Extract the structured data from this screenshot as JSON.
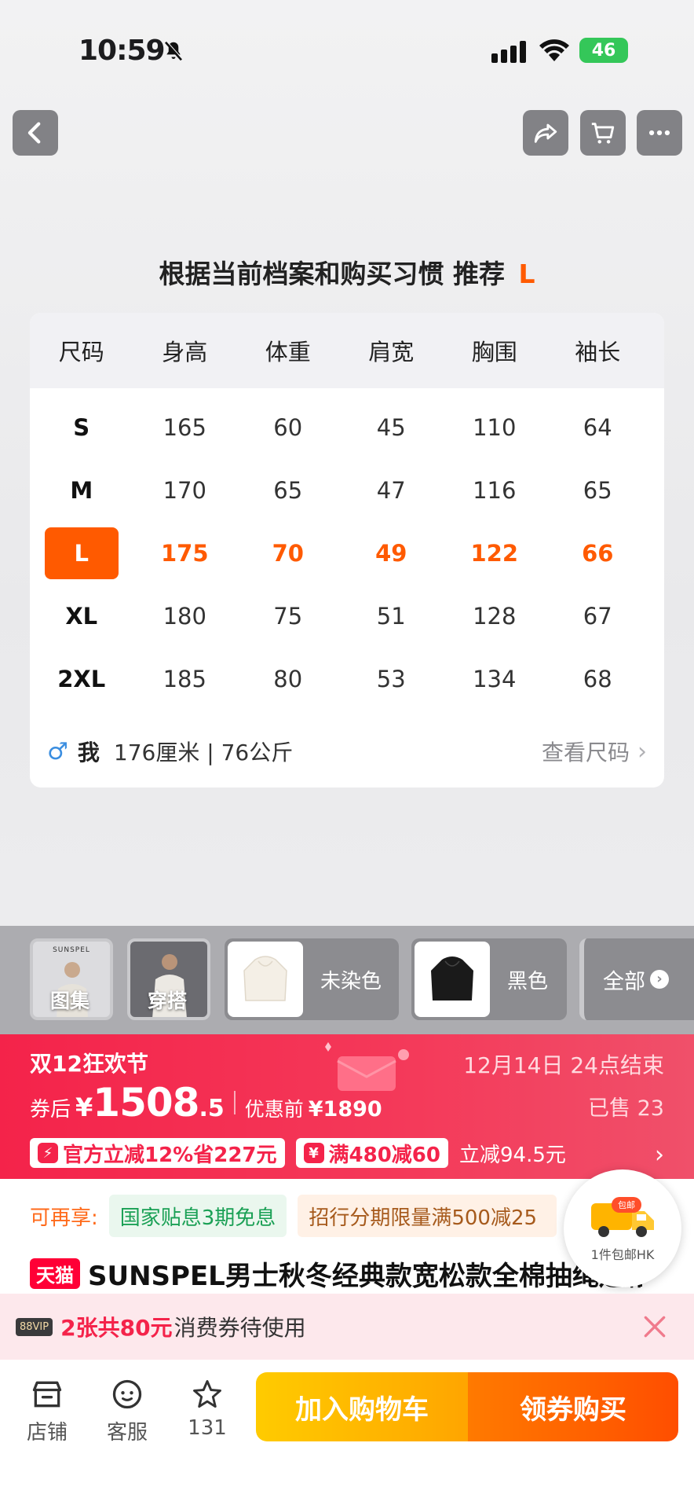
{
  "status_bar": {
    "time": "10:59",
    "battery": "46"
  },
  "recommend": {
    "text": "根据当前档案和购买习惯 推荐",
    "size": "L"
  },
  "size_table": {
    "headers": [
      "尺码",
      "身高",
      "体重",
      "肩宽",
      "胸围",
      "袖长"
    ],
    "rows": [
      [
        "S",
        "165",
        "60",
        "45",
        "110",
        "64"
      ],
      [
        "M",
        "170",
        "65",
        "47",
        "116",
        "65"
      ],
      [
        "L",
        "175",
        "70",
        "49",
        "122",
        "66"
      ],
      [
        "XL",
        "180",
        "75",
        "51",
        "128",
        "67"
      ],
      [
        "2XL",
        "185",
        "80",
        "53",
        "134",
        "68"
      ]
    ],
    "highlighted_row": "L",
    "me_label": "我",
    "me_stats": "176厘米 | 76公斤",
    "view_size": "查看尺码"
  },
  "thumbnails": {
    "gallery_label": "图集",
    "gallery_brand": "SUNSPEL",
    "outfit_label": "穿搭",
    "colors": [
      "未染色",
      "黑色"
    ],
    "all_label": "全部"
  },
  "promo": {
    "event": "双12狂欢节",
    "end_time": "12月14日 24点结束",
    "after_coupon": "券后",
    "yen": "¥",
    "price_int": "1508",
    "price_dec": ".5",
    "before_label": "优惠前",
    "before_price": "¥1890",
    "sold": "已售 23",
    "tag_official": "官方立减12%省227元",
    "tag_coupon": "满480减60",
    "tag_instant": "立减94.5元"
  },
  "info": {
    "enjoy_label": "可再享:",
    "chip_interest": "国家贴息3期免息",
    "chip_installment": "招行分期限量满500减25",
    "tmall": "天猫",
    "title": "SUNSPEL男士秋冬经典款宽松款全棉抽绳连帽卫衣",
    "ship_badge": "包邮",
    "ship_text": "1件包邮HK"
  },
  "coupon_bar": {
    "vip": "88VIP",
    "count": "2张共80元",
    "text": "消费券待使用"
  },
  "bottom_bar": {
    "store": "店铺",
    "service": "客服",
    "favorites": "131",
    "add_cart": "加入购物车",
    "buy": "领券购买"
  },
  "colors": {
    "accent": "#ff5a00",
    "promo_red": "#f4234a",
    "cart_yellow": "#ffb400",
    "buy_orange": "#ff5a00"
  }
}
